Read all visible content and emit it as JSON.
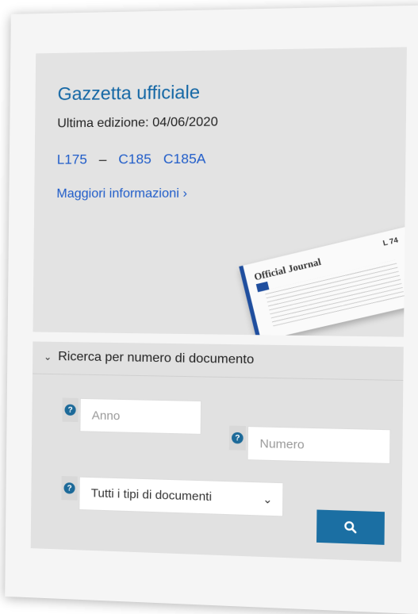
{
  "oj_panel": {
    "title": "Gazzetta ufficiale",
    "edition": "Ultima edizione: 04/06/2020",
    "links": [
      "L175",
      "C185",
      "C185A"
    ],
    "dash": "–",
    "more_info": "Maggiori informazioni ›",
    "thumbnail": {
      "title": "Official Journal",
      "code": "L 74"
    }
  },
  "search": {
    "header_icon": "chevron-down-icon",
    "title": "Ricerca per numero di documento",
    "help_icon": "question-circle-icon",
    "help_glyph": "?",
    "year_placeholder": "Anno",
    "number_placeholder": "Numero",
    "doc_type_selected": "Tutti i tipi di documenti",
    "search_icon": "magnifier-icon"
  },
  "colors": {
    "accent": "#1b6fa3",
    "link": "#1f5cc9",
    "title": "#1467a5",
    "panel_bg": "#e3e3e3"
  }
}
